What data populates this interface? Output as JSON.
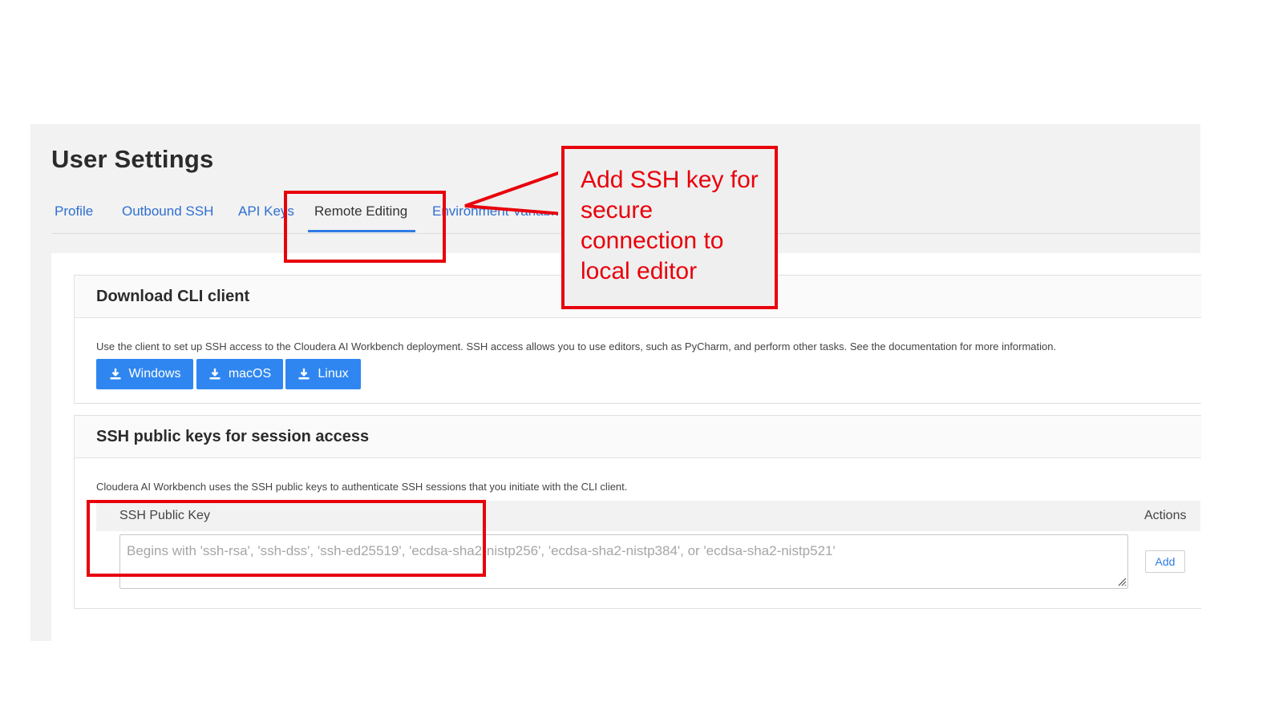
{
  "page_title": "User Settings",
  "tabs": [
    {
      "label": "Profile"
    },
    {
      "label": "Outbound SSH"
    },
    {
      "label": "API Keys"
    },
    {
      "label": "Remote Editing",
      "active": true
    },
    {
      "label": "Environment Variables"
    }
  ],
  "cli_section": {
    "title": "Download CLI client",
    "description": "Use the client to set up SSH access to the Cloudera AI Workbench deployment. SSH access allows you to use editors, such as PyCharm, and perform other tasks. See the documentation for more information.",
    "buttons": [
      {
        "label": "Windows",
        "icon": "download-icon"
      },
      {
        "label": "macOS",
        "icon": "download-icon"
      },
      {
        "label": "Linux",
        "icon": "download-icon"
      }
    ]
  },
  "ssh_section": {
    "title": "SSH public keys for session access",
    "description": "Cloudera AI Workbench uses the SSH public keys to authenticate SSH sessions that you initiate with the CLI client.",
    "table_headers": {
      "key": "SSH Public Key",
      "actions": "Actions"
    },
    "key_input": {
      "value": "",
      "placeholder": "Begins with 'ssh-rsa', 'ssh-dss', 'ssh-ed25519', 'ecdsa-sha2-nistp256', 'ecdsa-sha2-nistp384', or 'ecdsa-sha2-nistp521'"
    },
    "add_label": "Add"
  },
  "annotation": {
    "callout_text": "Add SSH key for secure connection to local editor",
    "highlight_color": "#e8000b"
  },
  "colors": {
    "link_blue": "#2f6fd1",
    "button_blue": "#2f86f0",
    "accent_underline": "#2f7be5"
  }
}
